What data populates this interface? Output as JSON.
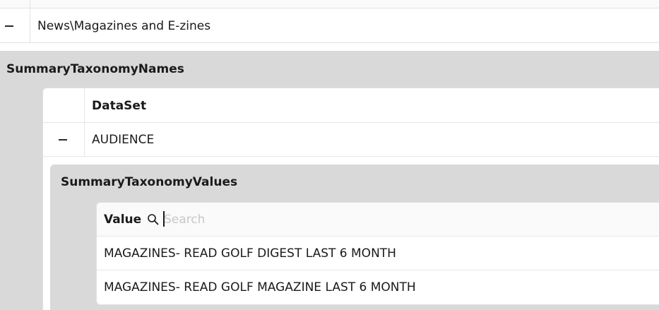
{
  "top_row": {
    "category": "News\\Magazines and E-zines"
  },
  "summary_taxonomy_names": {
    "title": "SummaryTaxonomyNames",
    "column_header": "DataSet",
    "rows": [
      "AUDIENCE"
    ]
  },
  "summary_taxonomy_values": {
    "title": "SummaryTaxonomyValues",
    "column_header": "Value",
    "search_placeholder": "Search",
    "rows": [
      "MAGAZINES- READ GOLF DIGEST LAST 6 MONTH",
      "MAGAZINES- READ GOLF MAGAZINE LAST 6 MONTH"
    ]
  },
  "icons": {
    "collapse": "minus-collapse-icon",
    "search": "search-icon"
  }
}
